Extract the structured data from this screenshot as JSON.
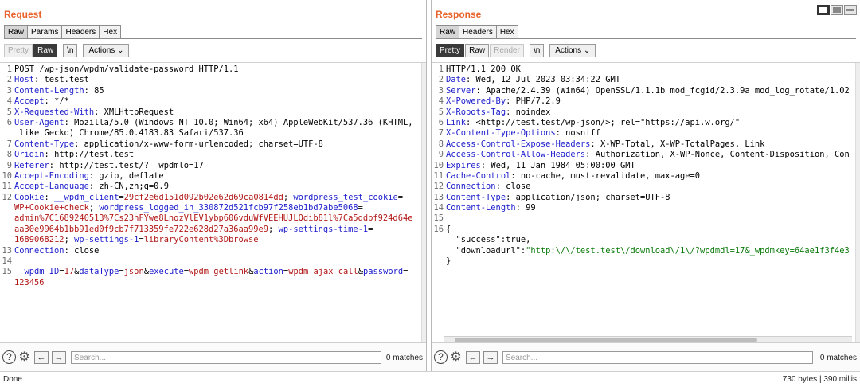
{
  "request": {
    "title": "Request",
    "tabs": [
      "Raw",
      "Params",
      "Headers",
      "Hex"
    ],
    "toolbar": {
      "pretty": "Pretty",
      "raw": "Raw",
      "newline": "\\n",
      "actions": "Actions"
    },
    "lines": [
      {
        "n": "1",
        "name": "",
        "value": "POST /wp-json/wpdm/validate-password HTTP/1.1"
      },
      {
        "n": "2",
        "name": "Host",
        "value": " test.test"
      },
      {
        "n": "3",
        "name": "Content-Length",
        "value": " 85"
      },
      {
        "n": "4",
        "name": "Accept",
        "value": " */*"
      },
      {
        "n": "5",
        "name": "X-Requested-With",
        "value": " XMLHttpRequest"
      },
      {
        "n": "6",
        "name": "User-Agent",
        "value": " Mozilla/5.0 (Windows NT 10.0; Win64; x64) AppleWebKit/537.36 (KHTML,"
      },
      {
        "n": "",
        "name": "",
        "value": " like Gecko) Chrome/85.0.4183.83 Safari/537.36"
      },
      {
        "n": "7",
        "name": "Content-Type",
        "value": " application/x-www-form-urlencoded; charset=UTF-8"
      },
      {
        "n": "8",
        "name": "Origin",
        "value": " http://test.test"
      },
      {
        "n": "9",
        "name": "Referer",
        "value": " http://test.test/?__wpdmlo=17"
      },
      {
        "n": "10",
        "name": "Accept-Encoding",
        "value": " gzip, deflate"
      },
      {
        "n": "11",
        "name": "Accept-Language",
        "value": " zh-CN,zh;q=0.9"
      }
    ],
    "cookie": {
      "n": "12",
      "name": "Cookie",
      "parts": [
        [
          {
            "t": "k",
            "s": " __wpdm_client"
          },
          {
            "t": "e",
            "s": "="
          },
          {
            "t": "v",
            "s": "29cf2e6d151d092b02e62d69ca0814dd"
          },
          {
            "t": "e",
            "s": "; "
          },
          {
            "t": "k",
            "s": "wordpress_test_cookie"
          },
          {
            "t": "e",
            "s": "="
          }
        ],
        [
          {
            "t": "v",
            "s": "WP+Cookie+check"
          },
          {
            "t": "e",
            "s": "; "
          },
          {
            "t": "k",
            "s": "wordpress_logged_in_330872d521fcb97f258eb1bd7abe5068"
          },
          {
            "t": "e",
            "s": "="
          }
        ],
        [
          {
            "t": "v",
            "s": "admin%7C1689240513%7Cs23hFYwe8LnozVlEV1ybp606vduWfVEEHUJLQdib81l%7Ca5ddbf924d64e"
          }
        ],
        [
          {
            "t": "v",
            "s": "aa30e9964b1bb91ed0f9cb7f713359fe722e628d27a36aa99e9"
          },
          {
            "t": "e",
            "s": "; "
          },
          {
            "t": "k",
            "s": "wp-settings-time-1"
          },
          {
            "t": "e",
            "s": "="
          }
        ],
        [
          {
            "t": "v",
            "s": "1689068212"
          },
          {
            "t": "e",
            "s": "; "
          },
          {
            "t": "k",
            "s": "wp-settings-1"
          },
          {
            "t": "e",
            "s": "="
          },
          {
            "t": "v",
            "s": "libraryContent%3Dbrowse"
          }
        ]
      ]
    },
    "connection": {
      "n": "13",
      "name": "Connection",
      "value": " close"
    },
    "blank": {
      "n": "14"
    },
    "body": {
      "n": "15",
      "parts": [
        [
          {
            "t": "k",
            "s": "__wpdm_ID"
          },
          {
            "t": "e",
            "s": "="
          },
          {
            "t": "v",
            "s": "17"
          },
          {
            "t": "e",
            "s": "&"
          },
          {
            "t": "k",
            "s": "dataType"
          },
          {
            "t": "e",
            "s": "="
          },
          {
            "t": "v",
            "s": "json"
          },
          {
            "t": "e",
            "s": "&"
          },
          {
            "t": "k",
            "s": "execute"
          },
          {
            "t": "e",
            "s": "="
          },
          {
            "t": "v",
            "s": "wpdm_getlink"
          },
          {
            "t": "e",
            "s": "&"
          },
          {
            "t": "k",
            "s": "action"
          },
          {
            "t": "e",
            "s": "="
          },
          {
            "t": "v",
            "s": "wpdm_ajax_call"
          },
          {
            "t": "e",
            "s": "&"
          },
          {
            "t": "k",
            "s": "password"
          },
          {
            "t": "e",
            "s": "="
          }
        ],
        [
          {
            "t": "v",
            "s": "123456"
          }
        ]
      ]
    },
    "search": {
      "placeholder": "Search...",
      "matches": "0 matches"
    }
  },
  "response": {
    "title": "Response",
    "tabs": [
      "Raw",
      "Headers",
      "Hex"
    ],
    "toolbar": {
      "pretty": "Pretty",
      "raw": "Raw",
      "render": "Render",
      "newline": "\\n",
      "actions": "Actions"
    },
    "lines": [
      {
        "n": "1",
        "name": "",
        "value": "HTTP/1.1 200 OK"
      },
      {
        "n": "2",
        "name": "Date",
        "value": " Wed, 12 Jul 2023 03:34:22 GMT"
      },
      {
        "n": "3",
        "name": "Server",
        "value": " Apache/2.4.39 (Win64) OpenSSL/1.1.1b mod_fcgid/2.3.9a mod_log_rotate/1.02"
      },
      {
        "n": "4",
        "name": "X-Powered-By",
        "value": " PHP/7.2.9"
      },
      {
        "n": "5",
        "name": "X-Robots-Tag",
        "value": " noindex"
      },
      {
        "n": "6",
        "name": "Link",
        "value": " <http://test.test/wp-json/>; rel=\"https://api.w.org/\""
      },
      {
        "n": "7",
        "name": "X-Content-Type-Options",
        "value": " nosniff"
      },
      {
        "n": "8",
        "name": "Access-Control-Expose-Headers",
        "value": " X-WP-Total, X-WP-TotalPages, Link"
      },
      {
        "n": "9",
        "name": "Access-Control-Allow-Headers",
        "value": " Authorization, X-WP-Nonce, Content-Disposition, Con"
      },
      {
        "n": "10",
        "name": "Expires",
        "value": " Wed, 11 Jan 1984 05:00:00 GMT"
      },
      {
        "n": "11",
        "name": "Cache-Control",
        "value": " no-cache, must-revalidate, max-age=0"
      },
      {
        "n": "12",
        "name": "Connection",
        "value": " close"
      },
      {
        "n": "13",
        "name": "Content-Type",
        "value": " application/json; charset=UTF-8"
      },
      {
        "n": "14",
        "name": "Content-Length",
        "value": " 99"
      },
      {
        "n": "15",
        "name": "",
        "value": ""
      }
    ],
    "json": {
      "n": "16",
      "open": "{",
      "k1": "\"success\"",
      "v1": ":true,",
      "k2": "\"downloadurl\"",
      "colon": ":",
      "v2": "\"http:\\/\\/test.test\\/download\\/1\\/?wpdmdl=17&_wpdmkey=64ae1f3f4e3",
      "close": "}"
    },
    "search": {
      "placeholder": "Search...",
      "matches": "0 matches"
    }
  },
  "status": {
    "left": "Done",
    "right": "730 bytes | 390 millis"
  }
}
